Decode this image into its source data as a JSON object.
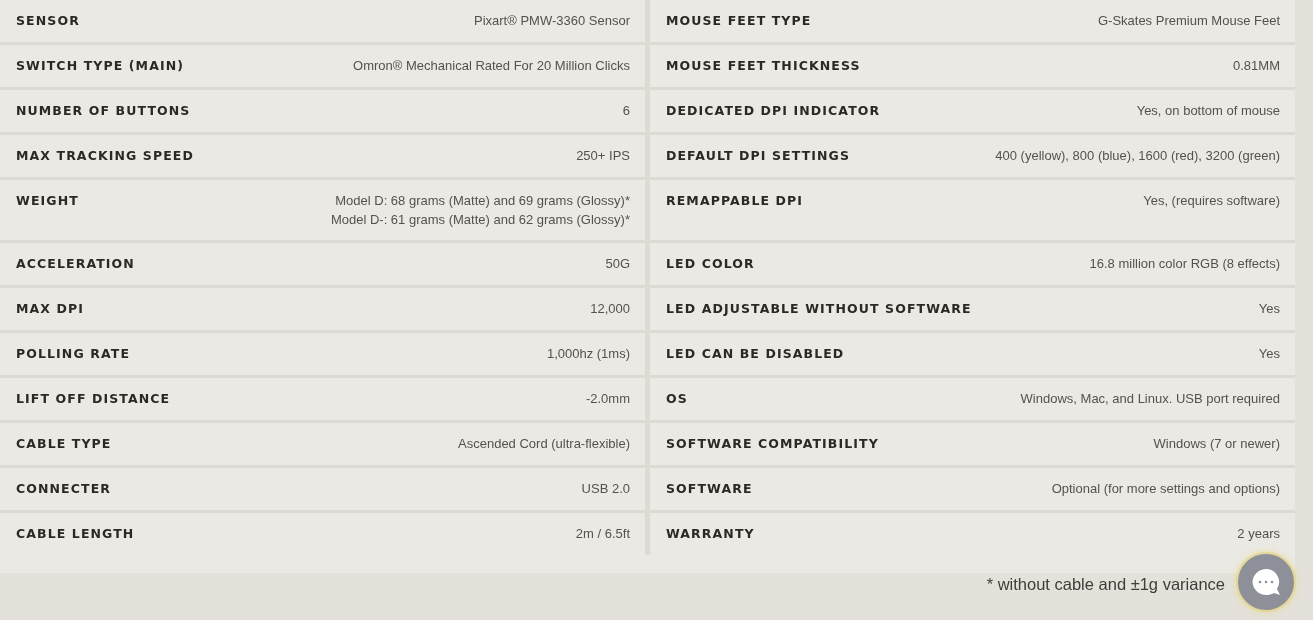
{
  "specs": [
    {
      "left": {
        "label": "SENSOR",
        "value": "Pixart® PMW-3360 Sensor"
      },
      "right": {
        "label": "MOUSE FEET TYPE",
        "value": "G-Skates Premium Mouse Feet"
      }
    },
    {
      "left": {
        "label": "SWITCH TYPE (MAIN)",
        "value": "Omron® Mechanical Rated For 20 Million Clicks"
      },
      "right": {
        "label": "MOUSE FEET THICKNESS",
        "value": "0.81MM"
      }
    },
    {
      "left": {
        "label": "NUMBER OF BUTTONS",
        "value": "6"
      },
      "right": {
        "label": "DEDICATED DPI INDICATOR",
        "value": "Yes, on bottom of mouse"
      }
    },
    {
      "left": {
        "label": "MAX TRACKING SPEED",
        "value": "250+ IPS"
      },
      "right": {
        "label": "DEFAULT DPI SETTINGS",
        "value": "400 (yellow), 800 (blue), 1600 (red), 3200 (green)"
      }
    },
    {
      "left": {
        "label": "WEIGHT",
        "value": "Model D: 68 grams (Matte) and 69 grams (Glossy)*\nModel D-: 61 grams (Matte) and 62 grams (Glossy)*"
      },
      "right": {
        "label": "REMAPPABLE DPI",
        "value": "Yes, (requires software)"
      }
    },
    {
      "left": {
        "label": "ACCELERATION",
        "value": "50G"
      },
      "right": {
        "label": "LED COLOR",
        "value": "16.8 million color RGB (8 effects)"
      }
    },
    {
      "left": {
        "label": "MAX DPI",
        "value": "12,000"
      },
      "right": {
        "label": "LED ADJUSTABLE WITHOUT SOFTWARE",
        "value": "Yes"
      }
    },
    {
      "left": {
        "label": "POLLING RATE",
        "value": "1,000hz (1ms)"
      },
      "right": {
        "label": "LED CAN BE DISABLED",
        "value": "Yes"
      }
    },
    {
      "left": {
        "label": "LIFT OFF DISTANCE",
        "value": "-2.0mm"
      },
      "right": {
        "label": "OS",
        "value": "Windows, Mac, and Linux. USB port required"
      }
    },
    {
      "left": {
        "label": "CABLE TYPE",
        "value": "Ascended Cord (ultra-flexible)"
      },
      "right": {
        "label": "SOFTWARE COMPATIBILITY",
        "value": "Windows (7 or newer)"
      }
    },
    {
      "left": {
        "label": "CONNECTER",
        "value": "USB 2.0"
      },
      "right": {
        "label": "SOFTWARE",
        "value": "Optional (for more settings and options)"
      }
    },
    {
      "left": {
        "label": "CABLE LENGTH",
        "value": "2m / 6.5ft"
      },
      "right": {
        "label": "WARRANTY",
        "value": "2 years"
      }
    }
  ],
  "footnote": "* without cable and ±1g variance"
}
